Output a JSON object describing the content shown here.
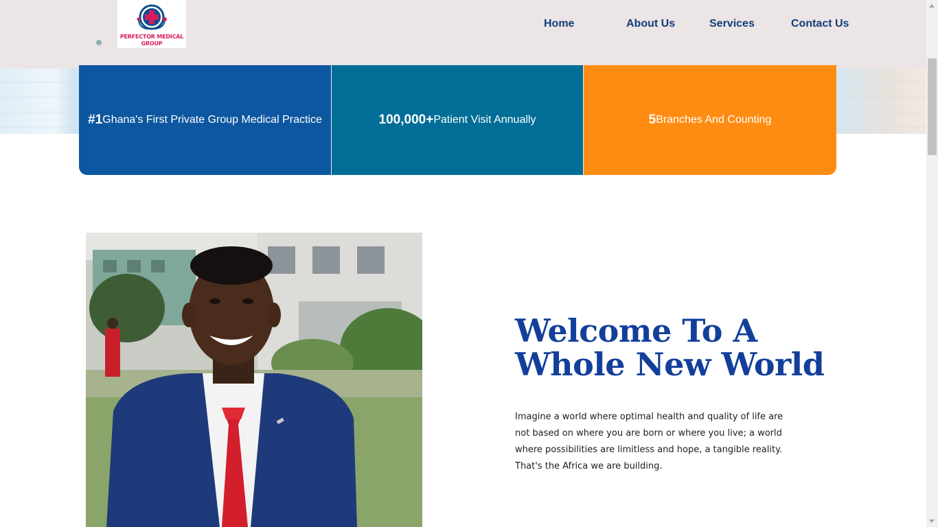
{
  "header": {
    "logo_text": "PERFECTOR MEDICAL GROUP",
    "nav": [
      {
        "label": "Home"
      },
      {
        "label": "About Us"
      },
      {
        "label": "Services"
      },
      {
        "label": "Contact Us"
      }
    ]
  },
  "stats": [
    {
      "value": "#1",
      "text": "Ghana's First Private Group Medical Practice",
      "color": "#0d57a1"
    },
    {
      "value": "100,000+",
      "text": "Patient Visit Annually",
      "color": "#006e96"
    },
    {
      "value": "5",
      "text": "Branches And Counting",
      "color": "#ff8c12"
    }
  ],
  "welcome": {
    "title_line1": "Welcome To A",
    "title_line2": "Whole New World",
    "body": "Imagine a world where optimal health and quality of life are not based on where you are born or where you live; a world where possibilities are limitless and hope, a tangible reality. That's the Africa we are building."
  },
  "icons": {
    "logo": "medical-cross-stethoscope-icon"
  },
  "colors": {
    "header_bg": "#ebe5e5",
    "nav_text": "#123d7a",
    "title": "#123f9a"
  }
}
